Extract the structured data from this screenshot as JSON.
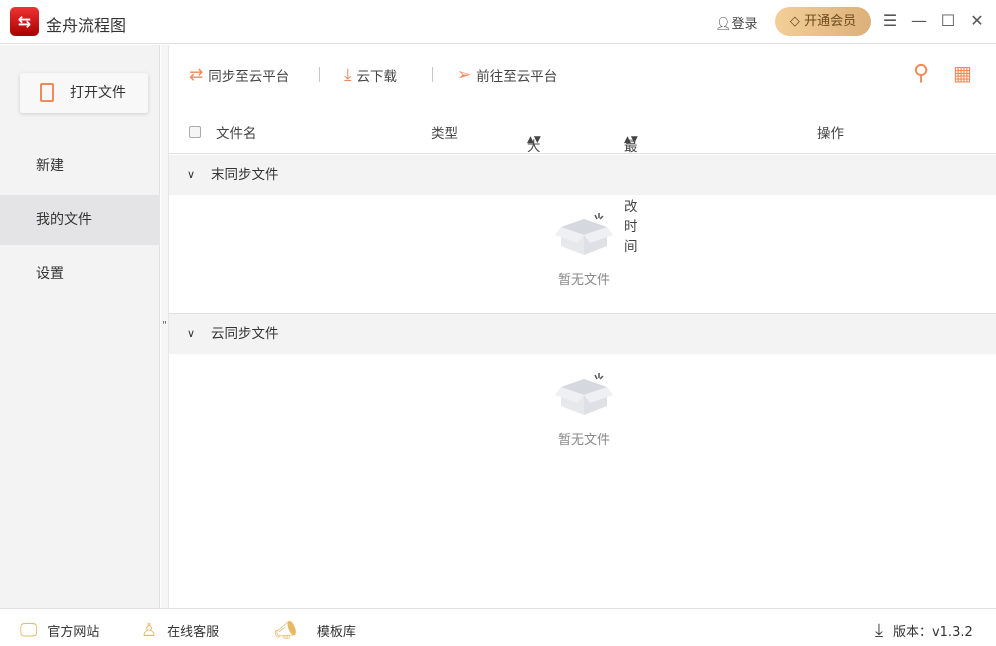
{
  "app": {
    "title": "金舟流程图",
    "login": "登录",
    "vip": "开通会员"
  },
  "sidebar": {
    "open_file": "打开文件",
    "items": [
      {
        "label": "新建"
      },
      {
        "label": "我的文件"
      },
      {
        "label": "设置"
      }
    ]
  },
  "toolbar": {
    "sync": "同步至云平台",
    "download": "云下载",
    "goto": "前往至云平台"
  },
  "table": {
    "headers": {
      "name": "文件名",
      "type": "类型",
      "size": "大小",
      "modified": "最后修改时间",
      "action": "操作"
    }
  },
  "sections": [
    {
      "title": "末同步文件",
      "empty": "暂无文件"
    },
    {
      "title": "云同步文件",
      "empty": "暂无文件"
    }
  ],
  "footer": {
    "website": "官方网站",
    "service": "在线客服",
    "templates": "模板库",
    "version": "版本：v1.3.2"
  },
  "colors": {
    "accent": "#f08a5a",
    "vip": "#e8c08a"
  }
}
